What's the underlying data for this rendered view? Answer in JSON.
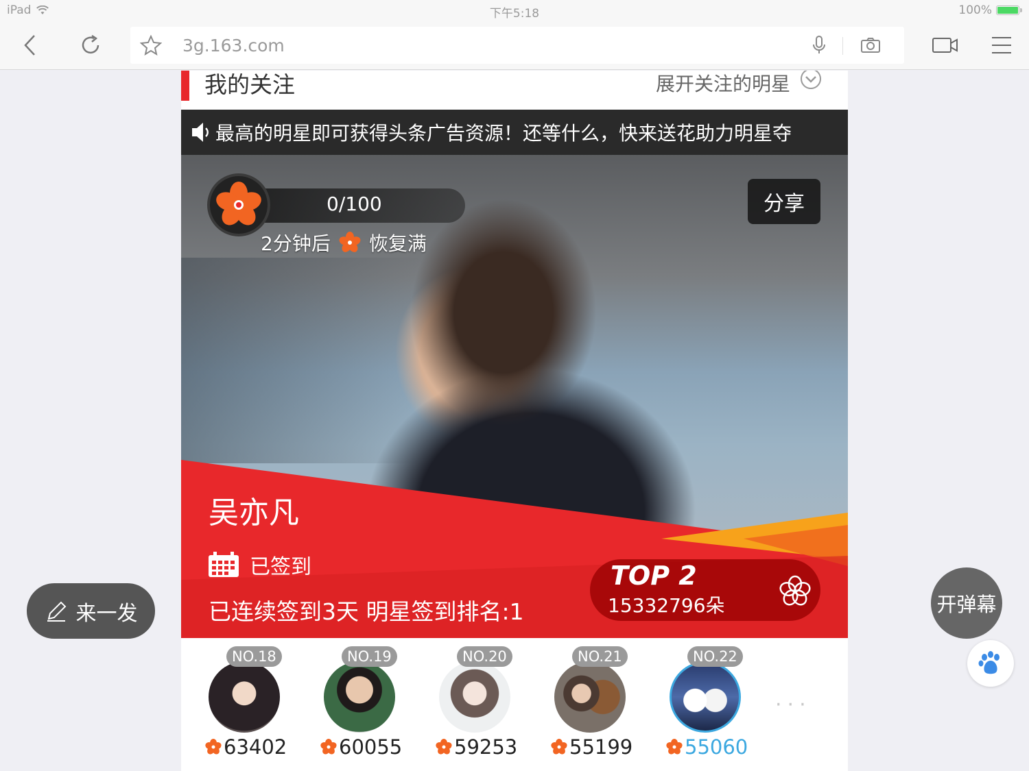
{
  "status_bar": {
    "device": "iPad",
    "time": "下午5:18",
    "battery": "100%"
  },
  "browser": {
    "url": "3g.163.com"
  },
  "section": {
    "title": "我的关注",
    "expand_label": "展开关注的明星"
  },
  "marquee": {
    "text": "最高的明星即可获得头条广告资源！还等什么，快来送花助力明星夺"
  },
  "flowers": {
    "count": "0/100",
    "recover_prefix": "2分钟后",
    "recover_suffix": "恢复满"
  },
  "share": {
    "label": "分享"
  },
  "star": {
    "name": "吴亦凡",
    "checkin_status": "已签到",
    "streak_text": "已连续签到3天 明星签到排名:1",
    "rank_label": "TOP 2",
    "total_flowers": "15332796朵"
  },
  "rankings": [
    {
      "badge": "NO.18",
      "score": "63402"
    },
    {
      "badge": "NO.19",
      "score": "60055"
    },
    {
      "badge": "NO.20",
      "score": "59253"
    },
    {
      "badge": "NO.21",
      "score": "55199"
    },
    {
      "badge": "NO.22",
      "score": "55060"
    }
  ],
  "floating": {
    "post_label": "来一发",
    "danmaku_label": "开弹幕"
  },
  "colors": {
    "accent_red": "#e8282b",
    "active_blue": "#3ca8e0",
    "flower_orange": "#f26522"
  }
}
